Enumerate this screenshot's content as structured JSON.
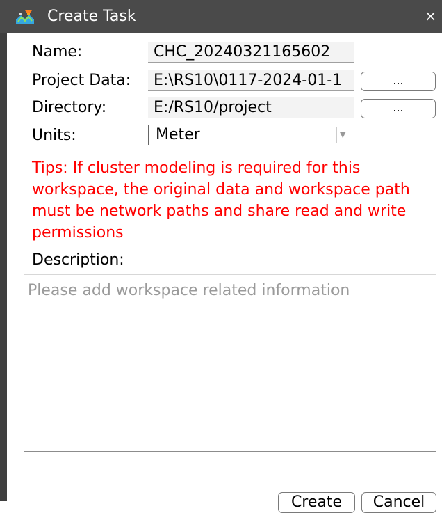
{
  "window": {
    "title": "Create Task",
    "close_glyph": "×",
    "app_icon": "app-logo-icon"
  },
  "form": {
    "name_label": "Name:",
    "name_value": "CHC_20240321165602",
    "project_data_label": "Project Data:",
    "project_data_value": "E:\\RS10\\0117-2024-01-1",
    "project_browse_label": "...",
    "directory_label": "Directory:",
    "directory_value": "E:/RS10/project",
    "directory_browse_label": "...",
    "units_label": "Units:",
    "units_value": "Meter",
    "units_arrow_glyph": "▼"
  },
  "tips": "Tips: If cluster modeling is required for this workspace, the original data and workspace path must be network paths and share read and write permissions",
  "description": {
    "label": "Description:",
    "placeholder": "Please add workspace related information"
  },
  "buttons": {
    "create": "Create",
    "cancel": "Cancel"
  },
  "colors": {
    "titlebar": "#4a4a4a",
    "tips_text": "#ff0000",
    "placeholder_text": "#9a9a9a"
  }
}
